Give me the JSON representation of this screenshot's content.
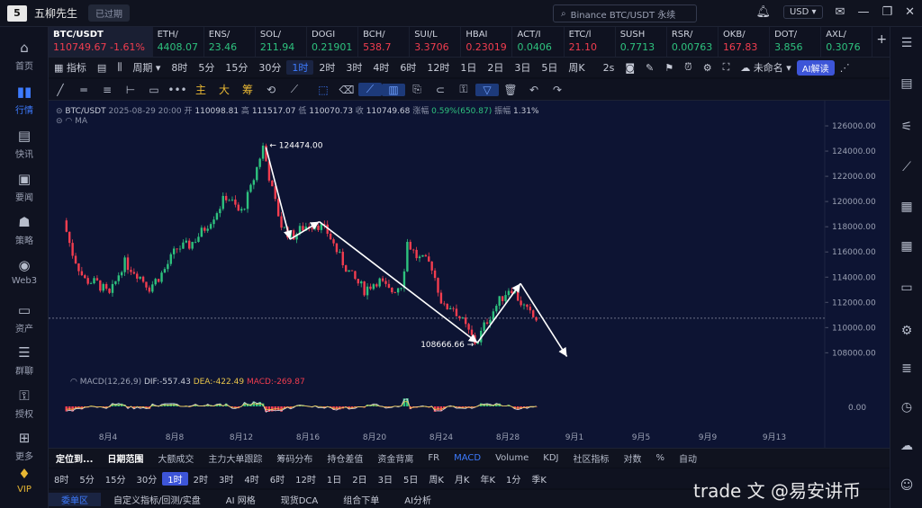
{
  "titlebar": {
    "app_name": "五柳先生",
    "expired_badge": "已过期",
    "search_placeholder": "Binance BTC/USDT 永续",
    "currency": "USD"
  },
  "sidebar": {
    "items": [
      {
        "label": "首页",
        "icon": "home-icon"
      },
      {
        "label": "行情",
        "icon": "chart-bar-icon"
      },
      {
        "label": "快讯",
        "icon": "news-icon"
      },
      {
        "label": "要闻",
        "icon": "document-icon"
      },
      {
        "label": "策略",
        "icon": "robot-icon"
      },
      {
        "label": "Web3",
        "icon": "web3-icon"
      },
      {
        "label": "资产",
        "icon": "wallet-icon"
      },
      {
        "label": "群聊",
        "icon": "chat-icon"
      },
      {
        "label": "授权",
        "icon": "key-icon"
      },
      {
        "label": "更多",
        "icon": "grid-icon"
      },
      {
        "label": "VIP",
        "icon": "vip-icon"
      }
    ]
  },
  "tickers": [
    {
      "name": "BTC/USDT",
      "price": "110749.67",
      "change": "-1.61%",
      "dir": "dn"
    },
    {
      "name": "ETH/",
      "price": "4408.07",
      "dir": "up"
    },
    {
      "name": "ENS/",
      "price": "23.46",
      "dir": "up"
    },
    {
      "name": "SOL/",
      "price": "211.94",
      "dir": "up"
    },
    {
      "name": "DOGI",
      "price": "0.21901",
      "dir": "up"
    },
    {
      "name": "BCH/",
      "price": "538.7",
      "dir": "dn"
    },
    {
      "name": "SUI/L",
      "price": "3.3706",
      "dir": "dn"
    },
    {
      "name": "HBAI",
      "price": "0.23019",
      "dir": "dn"
    },
    {
      "name": "ACT/I",
      "price": "0.0406",
      "dir": "up"
    },
    {
      "name": "ETC/l",
      "price": "21.10",
      "dir": "dn"
    },
    {
      "name": "SUSH",
      "price": "0.7713",
      "dir": "up"
    },
    {
      "name": "RSR/",
      "price": "0.00763",
      "dir": "up"
    },
    {
      "name": "OKB/",
      "price": "167.83",
      "dir": "dn"
    },
    {
      "name": "DOT/",
      "price": "3.856",
      "dir": "up"
    },
    {
      "name": "AXL/",
      "price": "0.3076",
      "dir": "up"
    }
  ],
  "toolbar1": {
    "indicator": "指标",
    "period": "周期",
    "intervals": [
      "8时",
      "5分",
      "15分",
      "30分",
      "1时",
      "2时",
      "3时",
      "4时",
      "6时",
      "12时",
      "1日",
      "2日",
      "3日",
      "5日",
      "周K"
    ],
    "active_interval": "1时",
    "refresh": "2s",
    "layout_name": "未命名",
    "ai_button": "AI解读"
  },
  "toolbar2": {
    "text_tools": [
      "主",
      "大",
      "筹"
    ]
  },
  "chart": {
    "legend": {
      "pair": "BTC/USDT",
      "datetime": "2025-08-29 20:00",
      "open_label": "开",
      "open": "110098.81",
      "high_label": "高",
      "high": "111517.07",
      "low_label": "低",
      "low": "110070.73",
      "close_label": "收",
      "close": "110749.68",
      "change_label": "涨幅",
      "change": "0.59%(650.87)",
      "amp_label": "振幅",
      "amp": "1.31%"
    },
    "ma_label": "MA",
    "macd": {
      "name": "MACD(12,26,9)",
      "dif": "DIF:-557.43",
      "dea": "DEA:-422.49",
      "macd": "MACD:-269.87"
    },
    "annotations": {
      "high_label": "← 124474.00",
      "low_label": "108666.66 →"
    }
  },
  "chart_data": {
    "type": "candlestick",
    "title": "",
    "xlabel": "",
    "ylabel": "",
    "x_ticks": [
      "8月4",
      "8月8",
      "8月12",
      "8月16",
      "8月20",
      "8月24",
      "8月28",
      "9月1",
      "9月5",
      "9月9",
      "9月13"
    ],
    "y_ticks": [
      108000,
      110000,
      112000,
      114000,
      116000,
      118000,
      120000,
      122000,
      124000,
      126000
    ],
    "y_tick_labels": [
      "108000.00",
      "110000.00",
      "112000.00",
      "114000.00",
      "116000.00",
      "118000.00",
      "120000.00",
      "122000.00",
      "124000.00",
      "126000.00"
    ],
    "ylim": [
      106600,
      127000
    ],
    "macd_tick_label": "0.00",
    "price_path": [
      {
        "day": 2.0,
        "price": 118500
      },
      {
        "day": 2.5,
        "price": 116000
      },
      {
        "day": 3.2,
        "price": 113800
      },
      {
        "day": 4.0,
        "price": 113500
      },
      {
        "day": 4.7,
        "price": 112500
      },
      {
        "day": 5.5,
        "price": 115200
      },
      {
        "day": 6.3,
        "price": 114300
      },
      {
        "day": 7.0,
        "price": 113200
      },
      {
        "day": 7.8,
        "price": 114400
      },
      {
        "day": 8.6,
        "price": 116300
      },
      {
        "day": 9.3,
        "price": 116500
      },
      {
        "day": 10.0,
        "price": 117500
      },
      {
        "day": 10.8,
        "price": 119000
      },
      {
        "day": 11.5,
        "price": 120500
      },
      {
        "day": 12.3,
        "price": 119000
      },
      {
        "day": 12.9,
        "price": 121000
      },
      {
        "day": 13.6,
        "price": 124400
      },
      {
        "day": 14.2,
        "price": 120500
      },
      {
        "day": 14.7,
        "price": 118000
      },
      {
        "day": 15.3,
        "price": 117200
      },
      {
        "day": 16.0,
        "price": 118000
      },
      {
        "day": 16.7,
        "price": 118300
      },
      {
        "day": 17.4,
        "price": 117500
      },
      {
        "day": 18.1,
        "price": 115500
      },
      {
        "day": 18.8,
        "price": 114000
      },
      {
        "day": 19.5,
        "price": 113000
      },
      {
        "day": 20.3,
        "price": 113800
      },
      {
        "day": 21.0,
        "price": 112800
      },
      {
        "day": 21.7,
        "price": 113500
      },
      {
        "day": 22.0,
        "price": 116800
      },
      {
        "day": 22.6,
        "price": 115500
      },
      {
        "day": 23.4,
        "price": 115000
      },
      {
        "day": 24.1,
        "price": 111500
      },
      {
        "day": 24.6,
        "price": 111800
      },
      {
        "day": 25.4,
        "price": 110000
      },
      {
        "day": 26.0,
        "price": 108700
      },
      {
        "day": 26.6,
        "price": 110500
      },
      {
        "day": 27.3,
        "price": 112000
      },
      {
        "day": 28.0,
        "price": 113300
      },
      {
        "day": 28.5,
        "price": 112200
      },
      {
        "day": 29.0,
        "price": 111200
      },
      {
        "day": 29.4,
        "price": 110700
      }
    ],
    "trend_arrows": [
      [
        {
          "day": 13.6,
          "price": 124300
        },
        {
          "day": 15.0,
          "price": 117000
        }
      ],
      [
        {
          "day": 15.0,
          "price": 117000
        },
        {
          "day": 16.7,
          "price": 118400
        }
      ],
      [
        {
          "day": 16.7,
          "price": 118400
        },
        {
          "day": 25.9,
          "price": 108800
        }
      ],
      [
        {
          "day": 25.9,
          "price": 108800
        },
        {
          "day": 28.4,
          "price": 113500
        }
      ],
      [
        {
          "day": 28.4,
          "price": 113500
        },
        {
          "day": 31.1,
          "price": 107700
        }
      ]
    ],
    "current_price": 110749.67
  },
  "right_toolbar": {
    "icons": [
      "order-book-icon",
      "document-icon",
      "sliders-icon",
      "trend-icon",
      "clipboard-icon",
      "calendar-grid-icon",
      "chat-icon",
      "settings-circle-icon",
      "list-icon",
      "alert-icon",
      "cloud-icon",
      "users-icon"
    ]
  },
  "bottom1": {
    "items": [
      "定位到...",
      "日期范围",
      "大额成交",
      "主力大单跟踪",
      "筹码分布",
      "持仓差值",
      "资金背离",
      "FR",
      "MACD",
      "Volume",
      "KDJ",
      "社区指标",
      "对数",
      "%",
      "自动"
    ],
    "active": "MACD"
  },
  "bottom2": {
    "intervals": [
      "8时",
      "5分",
      "15分",
      "30分",
      "1时",
      "2时",
      "3时",
      "4时",
      "6时",
      "12时",
      "1日",
      "2日",
      "3日",
      "5日",
      "周K",
      "月K",
      "年K",
      "1分",
      "季K"
    ],
    "active": "1时"
  },
  "bottom3": {
    "tabs": [
      "委单区",
      "自定义指标/回测/实盘",
      "AI 网格",
      "现货DCA",
      "组合下单",
      "AI分析"
    ]
  },
  "watermark": "trade 文 @易安讲币"
}
